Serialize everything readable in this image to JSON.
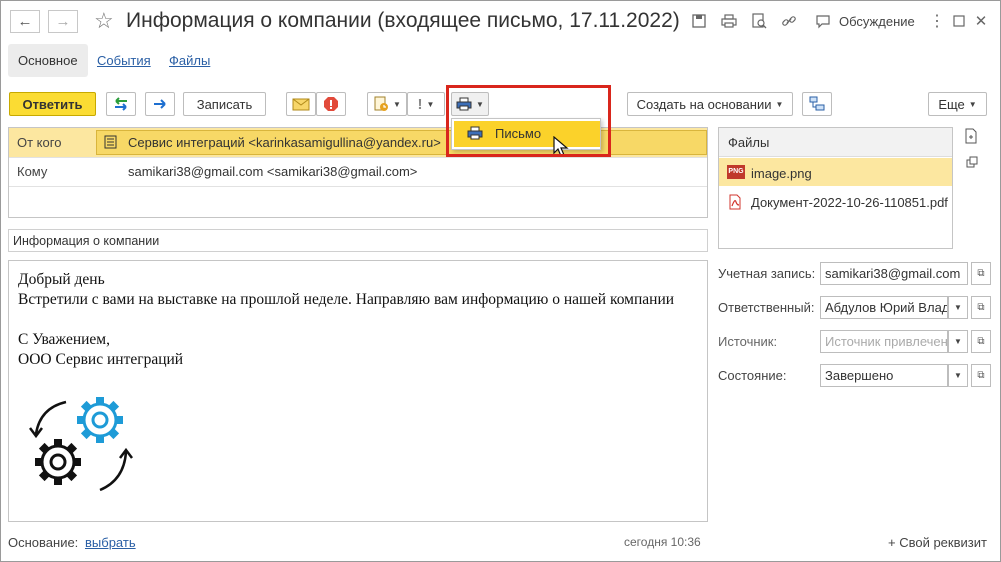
{
  "window": {
    "title": "Информация о компании (входящее письмо, 17.11.2022)",
    "discussion_label": "Обсуждение"
  },
  "tabs": [
    {
      "label": "Основное"
    },
    {
      "label": "События"
    },
    {
      "label": "Файлы"
    }
  ],
  "toolbar": {
    "reply_label": "Ответить",
    "save_label": "Записать",
    "create_based_on_label": "Создать на основании",
    "more_label": "Еще"
  },
  "print_menu": {
    "items": [
      {
        "label": "Письмо"
      }
    ]
  },
  "from": {
    "label": "От кого",
    "value": "Сервис интеграций <karinkasamigullina@yandex.ru>"
  },
  "to": {
    "label": "Кому",
    "value": "samikari38@gmail.com <samikari38@gmail.com>"
  },
  "subject": "Информация о компании",
  "letter": {
    "lines": [
      "Добрый день",
      "Встретили с вами на выставке на прошлой неделе. Направляю вам информацию о нашей компании",
      "",
      "С Уважением,",
      "ООО Сервис интеграций"
    ]
  },
  "files": {
    "header": "Файлы",
    "items": [
      {
        "name": "image.png",
        "type": "PNG"
      },
      {
        "name": "Документ-2022-10-26-110851.pdf",
        "type": "PDF"
      }
    ]
  },
  "props": {
    "account": {
      "label": "Учетная запись:",
      "value": "samikari38@gmail.com"
    },
    "responsible": {
      "label": "Ответственный:",
      "value": "Абдулов Юрий Влад"
    },
    "source": {
      "label": "Источник:",
      "placeholder": "Источник привлечен"
    },
    "state": {
      "label": "Состояние:",
      "value": "Завершено"
    }
  },
  "footer": {
    "basis_label": "Основание:",
    "basis_link": "выбрать",
    "timestamp": "сегодня 10:36",
    "add_attribute": "+ Свой реквизит"
  },
  "colors": {
    "accent_yellow": "#fbdc33",
    "selected_row": "#fce7a0",
    "highlight_red": "#d9261c",
    "link_blue": "#2a5fa5",
    "icon_blue": "#1e9bd7"
  }
}
